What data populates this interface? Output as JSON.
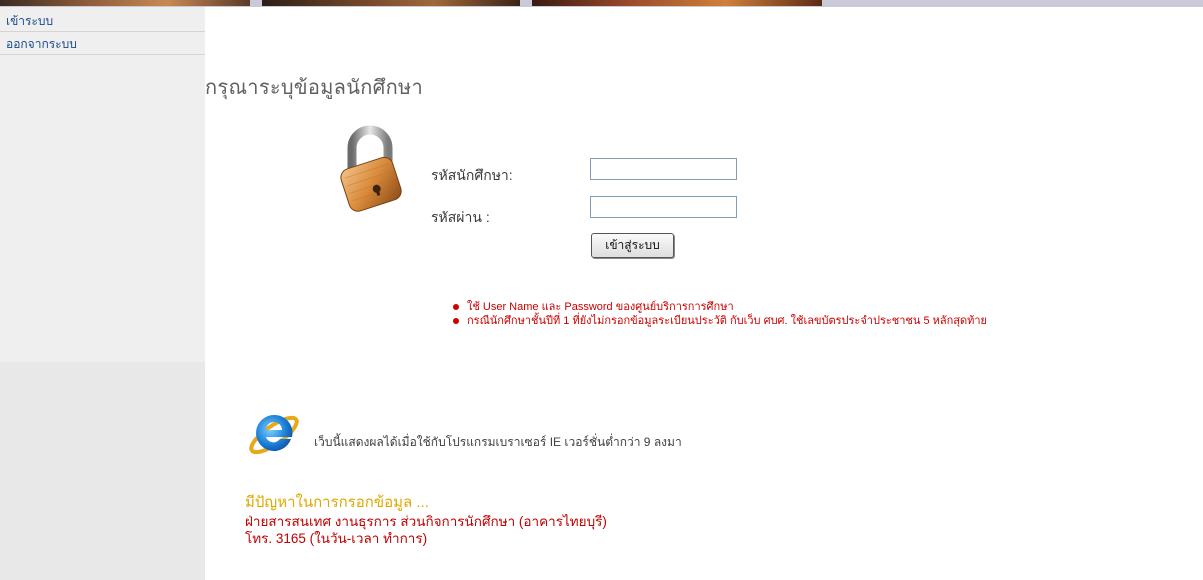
{
  "sidebar": {
    "items": [
      {
        "label": "เข้าระบบ"
      },
      {
        "label": "ออกจากระบบ"
      }
    ]
  },
  "main": {
    "title": "กรุณาระบุข้อมูลนักศึกษา",
    "form": {
      "student_id_label": "รหัสนักศึกษา:",
      "student_id_value": "",
      "password_label": "รหัสผ่าน :",
      "password_value": "",
      "submit_label": "เข้าสู่ระบบ"
    },
    "notes": [
      "ใช้ User Name และ Password ของศูนย์บริการการศึกษา",
      "กรณีนักศึกษาชั้นปีที่ 1 ที่ยังไม่กรอกข้อมูลระเบียนประวัติ กับเว็บ ศบศ. ใช้เลขบัตรประจำประชาชน 5 หลักสุดท้าย"
    ],
    "browser_notice": "เว็บนี้แสดงผลได้เมื่อใช้กับโปรแกรมเบราเซอร์ IE เวอร์ชั่นต่ำกว่า 9 ลงมา",
    "help": {
      "heading": "มีปัญหาในการกรอกข้อมูล ...",
      "line1": "ฝ่ายสารสนเทศ งานธุรการ ส่วนกิจการนักศึกษา (อาคารไทยบุรี)",
      "line2": "โทร. 3165 (ในวัน-เวลา ทำการ)"
    }
  },
  "colors": {
    "sidebar_bg": "#efefef",
    "link": "#1a4a8a",
    "note_red": "#cc0000",
    "help_heading": "#e0a800"
  },
  "icons": [
    "padlock-icon",
    "internet-explorer-icon"
  ]
}
